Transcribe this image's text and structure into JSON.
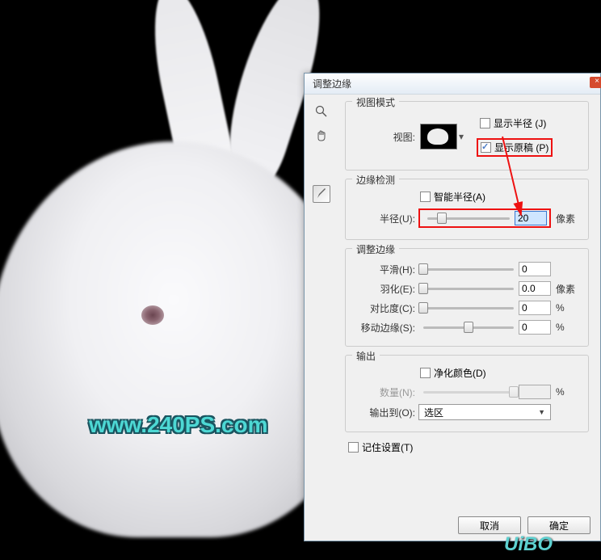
{
  "dialog": {
    "title": "调整边缘",
    "close": "×"
  },
  "view_mode": {
    "group_title": "视图模式",
    "view_label": "视图:",
    "show_radius": {
      "label": "显示半径 (J)",
      "checked": false
    },
    "show_original": {
      "label": "显示原稿 (P)",
      "checked": true
    }
  },
  "edge_detection": {
    "group_title": "边缘检测",
    "smart_radius": {
      "label": "智能半径(A)",
      "checked": false
    },
    "radius": {
      "label": "半径(U):",
      "value": "20",
      "unit": "像素",
      "pos": 18
    }
  },
  "adjust_edges": {
    "group_title": "调整边缘",
    "smooth": {
      "label": "平滑(H):",
      "value": "0",
      "pos": 0
    },
    "feather": {
      "label": "羽化(E):",
      "value": "0.0",
      "unit": "像素",
      "pos": 0
    },
    "contrast": {
      "label": "对比度(C):",
      "value": "0",
      "unit": "%",
      "pos": 0
    },
    "shift_edge": {
      "label": "移动边缘(S):",
      "value": "0",
      "unit": "%",
      "pos": 50
    }
  },
  "output": {
    "group_title": "输出",
    "purify": {
      "label": "净化颜色(D)",
      "checked": false
    },
    "amount": {
      "label": "数量(N):",
      "value": "",
      "unit": "%",
      "disabled": true,
      "pos": 100
    },
    "output_to": {
      "label": "输出到(O):",
      "value": "选区"
    }
  },
  "remember": {
    "label": "记住设置(T)",
    "checked": false
  },
  "buttons": {
    "cancel": "取消",
    "ok": "确定"
  },
  "watermark": "www.240PS.com",
  "uibo": "UiBO",
  "icons": {
    "zoom": "zoom-icon",
    "hand": "hand-icon",
    "brush": "brush-icon"
  }
}
